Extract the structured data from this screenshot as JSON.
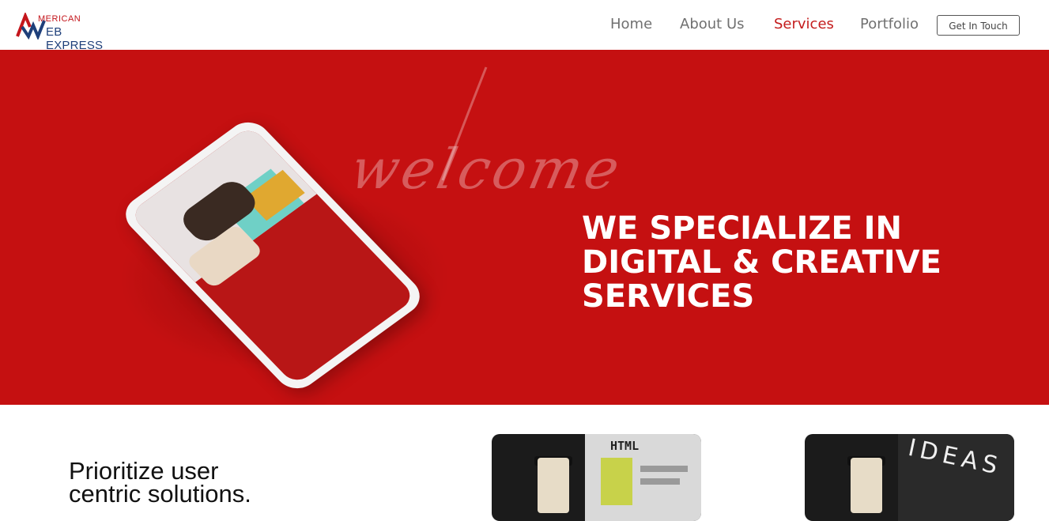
{
  "header": {
    "logo_top": "MERICAN",
    "logo_bottom": "EB EXPRESS",
    "logo_letters": "AW",
    "nav": [
      "Home",
      "About Us",
      "Services",
      "Portfolio"
    ],
    "active_nav": "Services",
    "cta_label": "Get In Touch"
  },
  "hero": {
    "script_text": "welcome",
    "headline_lines": [
      "WE SPECIALIZE IN",
      "DIGITAL & CREATIVE",
      "SERVICES"
    ]
  },
  "content": {
    "title_lines": [
      "Prioritize user",
      "centric solutions."
    ],
    "card1_label": "HTML",
    "card2_label": "IDEAS"
  },
  "colors": {
    "brand_red": "#c51011",
    "brand_blue": "#1e3f7a",
    "nav_text": "#707070",
    "nav_active": "#c41c1c"
  }
}
